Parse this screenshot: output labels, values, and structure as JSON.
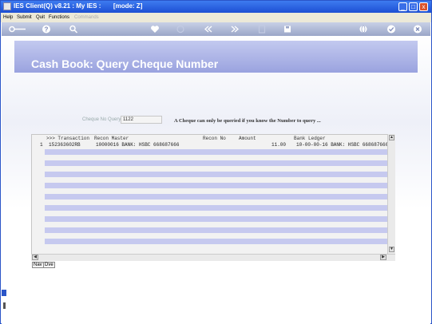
{
  "window": {
    "title": "IES Client(Q) v8.21 : My IES :       [mode: Z]",
    "minimize_glyph": "_",
    "maximize_glyph": "□",
    "close_glyph": "x"
  },
  "menu": [
    "Help",
    "Submit",
    "Quit",
    "Functions",
    "Commands"
  ],
  "toolbar": {
    "icons": [
      "key-icon",
      "help-icon",
      "search-icon",
      "heart-icon",
      "refresh-icon",
      "rewind-icon",
      "fast-forward-icon",
      "clipboard-icon",
      "save-icon",
      "globe-icon",
      "check-icon",
      "close-icon"
    ]
  },
  "page": {
    "title": "Cash Book: Query Cheque Number"
  },
  "query": {
    "label": "Cheque No Query",
    "value": "1122",
    "hint": "A Cheque can only be queried if you know the Number to query ..."
  },
  "grid": {
    "columns": [
      ">>> Transaction",
      "Recon Master",
      "Recon No",
      "Amount",
      "Bank Ledger"
    ],
    "rows": [
      {
        "index": "1",
        "transaction": "152363602RB",
        "recon_master": "10000016 BANK: HSBC 668687666",
        "recon_no": "",
        "amount": "11.00",
        "bank_ledger": "10-00-00-16 BANK: HSBC 668687666"
      }
    ]
  },
  "nav": {
    "nav_label": "Nav",
    "dve_label": "Dve"
  },
  "colors": {
    "titlebar": "#1d4fd3",
    "banner": "#9aa3df",
    "row_stripe": "#c6c9ef"
  }
}
